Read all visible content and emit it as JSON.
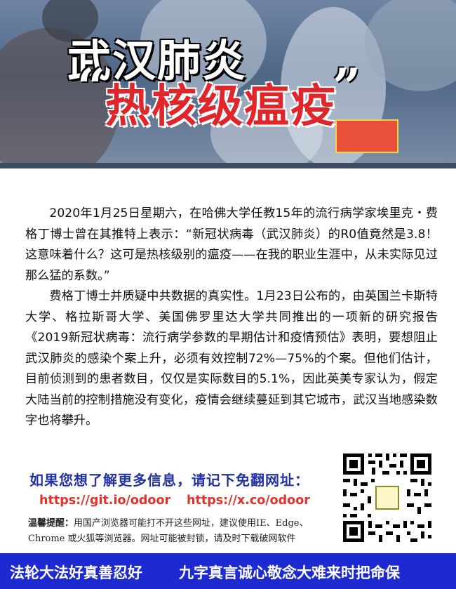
{
  "hero": {
    "title_line1": "武汉肺炎",
    "title_line2": "热核级瘟疫",
    "open_quote": "“",
    "close_quote": "”"
  },
  "article": {
    "paragraphs": [
      "2020年1月25日星期六，在哈佛大学任教15年的流行病学家埃里克・费格丁博士曾在其推特上表示：“新冠状病毒（武汉肺炎）的R0值竟然是3.8！这意味着什么？这可是热核级别的瘟疫——在我的职业生涯中，从未实际见过那么猛的系数。”",
      "费格丁博士并质疑中共数据的真实性。1月23日公布的，由英国兰卡斯特大学、格拉斯哥大学、美国佛罗里达大学共同推出的一项新的研究报告《2019新冠状病毒：流行病学参数的早期估计和疫情预估》表明，要想阻止武汉肺炎的感染个案上升，必须有效控制72%—75%的个案。但他们估计，目前侦测到的患者数目，仅仅是实际数目的5.1%，因此英美专家认为，假定大陆当前的控制措施没有变化，疫情会继续蔓延到其它城市，武汉当地感染数字也将攀升。"
    ]
  },
  "cta": {
    "headline": "如果您想了解更多信息，请记下免翻网址：",
    "link1": "https://git.io/odoor",
    "link2": "https://x.co/odoor",
    "tip_label": "温馨提醒：",
    "tip_text": "用国产浏览器可能打不开这些网址，建议使用IE、Edge、Chrome 或火狐等浏览器。网址可能被封锁，请及时下载破网软件"
  },
  "footer": {
    "left": "法轮大法好真善忍好",
    "right": "九字真言诚心敬念大难来时把命保"
  },
  "colors": {
    "footer_bg": "#1d2ad0",
    "headline_blue": "#2233a6",
    "link_red": "#e0332b",
    "title_red": "#e1262b"
  }
}
